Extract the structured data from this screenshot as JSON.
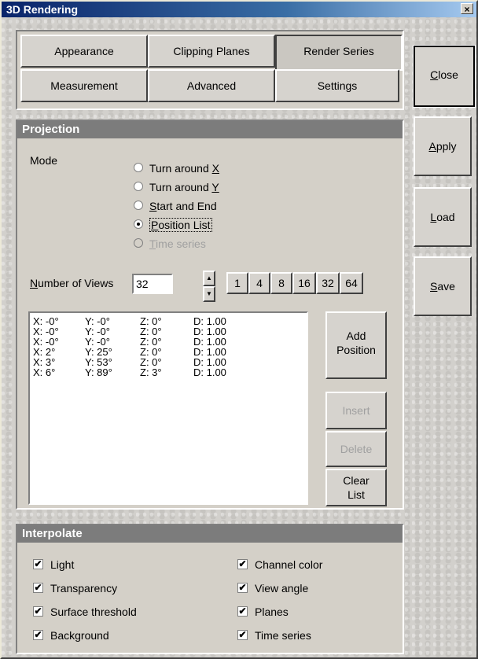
{
  "window": {
    "title": "3D Rendering",
    "close_glyph": "×"
  },
  "tabs": [
    {
      "label": "Appearance",
      "active": false
    },
    {
      "label": "Clipping Planes",
      "active": false
    },
    {
      "label": "Render Series",
      "active": true
    },
    {
      "label": "Measurement",
      "active": false
    },
    {
      "label": "Advanced",
      "active": false
    },
    {
      "label": "Settings",
      "active": false
    }
  ],
  "side_buttons": {
    "close": {
      "u": "C",
      "rest": "lose"
    },
    "apply": {
      "u": "A",
      "rest": "pply"
    },
    "load": {
      "u": "L",
      "rest": "oad"
    },
    "save": {
      "u": "S",
      "rest": "ave"
    }
  },
  "projection": {
    "header": "Projection",
    "mode_label": "Mode",
    "modes": [
      {
        "pre": "Turn around ",
        "u": "X",
        "post": "",
        "selected": false,
        "enabled": true
      },
      {
        "pre": "Turn around ",
        "u": "Y",
        "post": "",
        "selected": false,
        "enabled": true
      },
      {
        "pre": "",
        "u": "S",
        "post": "tart and End",
        "selected": false,
        "enabled": true
      },
      {
        "pre": "",
        "u": "P",
        "post": "osition List",
        "selected": true,
        "enabled": true
      },
      {
        "pre": "",
        "u": "T",
        "post": "ime series",
        "selected": false,
        "enabled": false
      }
    ],
    "num_views_label_u": "N",
    "num_views_label_rest": "umber of Views",
    "num_views_value": "32",
    "quick_views": [
      "1",
      "4",
      "8",
      "16",
      "32",
      "64"
    ],
    "positions": [
      {
        "x": "X: -0°",
        "y": "Y: -0°",
        "z": "Z: 0°",
        "d": "D: 1.00"
      },
      {
        "x": "X: -0°",
        "y": "Y: -0°",
        "z": "Z: 0°",
        "d": "D: 1.00"
      },
      {
        "x": "X: -0°",
        "y": "Y: -0°",
        "z": "Z: 0°",
        "d": "D: 1.00"
      },
      {
        "x": "X: 2°",
        "y": "Y: 25°",
        "z": "Z: 0°",
        "d": "D: 1.00"
      },
      {
        "x": "X: 3°",
        "y": "Y: 53°",
        "z": "Z: 0°",
        "d": "D: 1.00"
      },
      {
        "x": "X: 6°",
        "y": "Y: 89°",
        "z": "Z: 3°",
        "d": "D: 1.00"
      }
    ],
    "add_position_line1": "Add",
    "add_position_line2": "Position",
    "insert_label": "Insert",
    "delete_label": "Delete",
    "clear_list_line1": "Clear",
    "clear_list_line2": "List"
  },
  "interpolate": {
    "header": "Interpolate",
    "left": [
      {
        "label": "Light",
        "checked": true
      },
      {
        "label": "Transparency",
        "checked": true
      },
      {
        "label": "Surface threshold",
        "checked": true
      },
      {
        "label": "Background",
        "checked": true
      }
    ],
    "right": [
      {
        "label": "Channel color",
        "checked": true
      },
      {
        "label": "View angle",
        "checked": true
      },
      {
        "label": "Planes",
        "checked": true
      },
      {
        "label": "Time series",
        "checked": true
      }
    ],
    "check_glyph": "✔"
  }
}
